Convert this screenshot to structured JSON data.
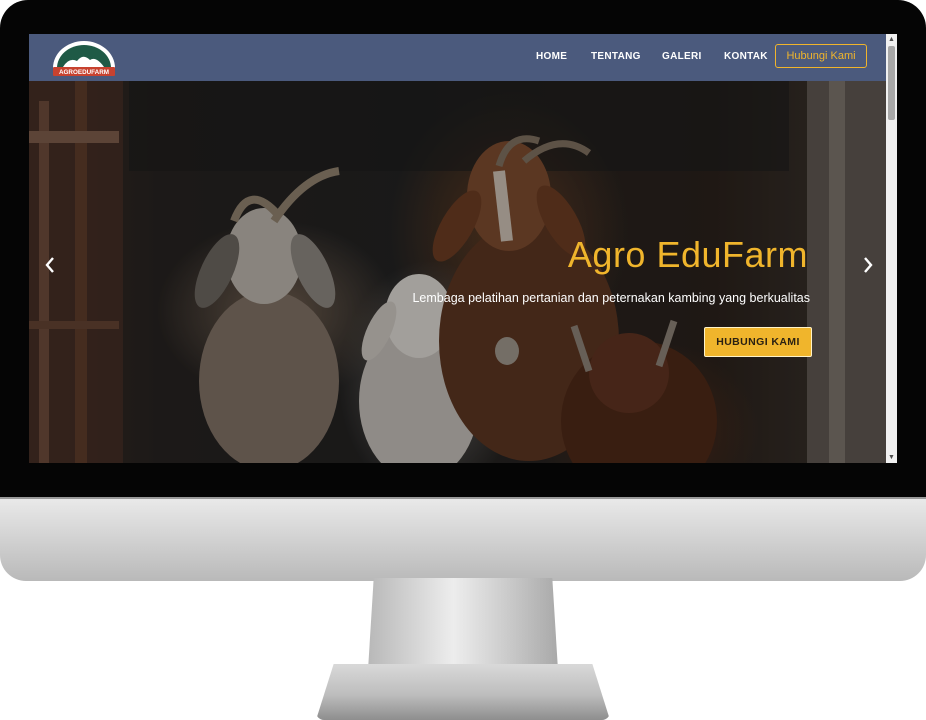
{
  "brand": {
    "logo_text": "AGROEDUFARM",
    "colors": {
      "navbar": "#4b5a7d",
      "accent": "#f0b52c",
      "logo_green": "#1f5a46",
      "logo_red": "#c7422f"
    }
  },
  "nav": {
    "items": [
      {
        "label": "HOME"
      },
      {
        "label": "TENTANG"
      },
      {
        "label": "GALERI"
      },
      {
        "label": "KONTAK"
      }
    ],
    "cta_label": "Hubungi Kami"
  },
  "hero": {
    "title": "Agro EduFarm",
    "subtitle": "Lembaga pelatihan pertanian dan peternakan kambing yang berkualitas",
    "button_label": "HUBUNGI KAMI",
    "prev_icon": "chevron-left-icon",
    "next_icon": "chevron-right-icon"
  }
}
